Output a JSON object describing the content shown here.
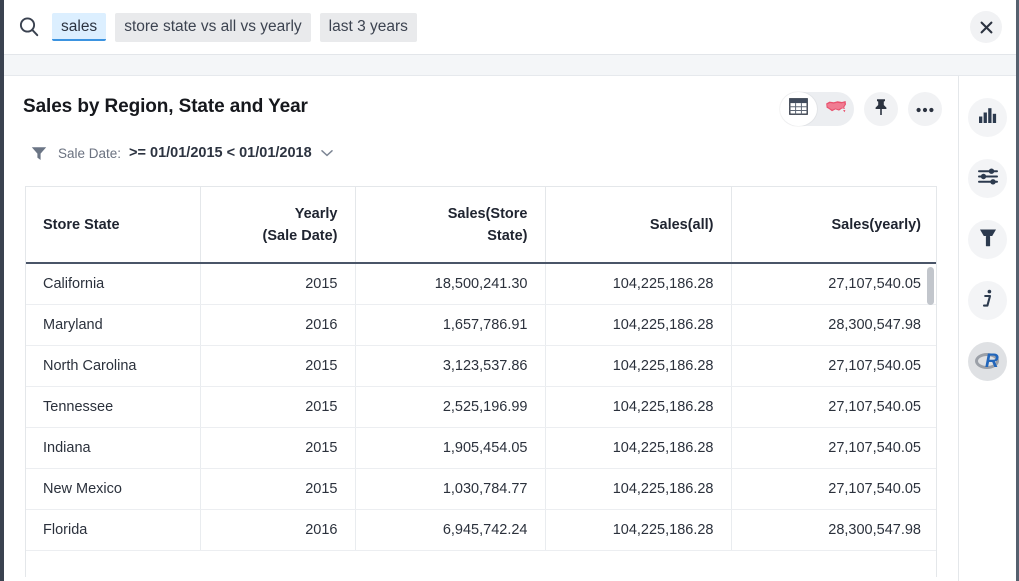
{
  "search": {
    "icon": "search-icon",
    "tokens": [
      {
        "label": "sales",
        "state": "active"
      },
      {
        "label": "store state vs all vs yearly",
        "state": "plain"
      },
      {
        "label": "last 3 years",
        "state": "plain"
      }
    ],
    "close_label": "✕"
  },
  "card": {
    "title": "Sales by Region, State and Year",
    "view_toggle": {
      "options": [
        {
          "name": "table-view",
          "selected": true
        },
        {
          "name": "map-view",
          "selected": false
        }
      ]
    },
    "actions": [
      {
        "name": "pin-button",
        "icon": "pin-icon"
      },
      {
        "name": "more-button",
        "icon": "ellipsis-icon"
      }
    ]
  },
  "filter": {
    "icon": "filter-icon",
    "label": "Sale Date:",
    "value": ">= 01/01/2015 < 01/01/2018",
    "caret": "chevron-down-icon"
  },
  "table": {
    "columns": [
      "Store State",
      "Yearly\n(Sale Date)",
      "Sales(Store\nState)",
      "Sales(all)",
      "Sales(yearly)"
    ],
    "columns_lines": [
      [
        "Store State"
      ],
      [
        "Yearly",
        "(Sale Date)"
      ],
      [
        "Sales(Store",
        "State)"
      ],
      [
        "Sales(all)"
      ],
      [
        "Sales(yearly)"
      ]
    ],
    "rows": [
      [
        "California",
        "2015",
        "18,500,241.30",
        "104,225,186.28",
        "27,107,540.05"
      ],
      [
        "Maryland",
        "2016",
        "1,657,786.91",
        "104,225,186.28",
        "28,300,547.98"
      ],
      [
        "North Carolina",
        "2015",
        "3,123,537.86",
        "104,225,186.28",
        "27,107,540.05"
      ],
      [
        "Tennessee",
        "2015",
        "2,525,196.99",
        "104,225,186.28",
        "27,107,540.05"
      ],
      [
        "Indiana",
        "2015",
        "1,905,454.05",
        "104,225,186.28",
        "27,107,540.05"
      ],
      [
        "New Mexico",
        "2015",
        "1,030,784.77",
        "104,225,186.28",
        "27,107,540.05"
      ],
      [
        "Florida",
        "2016",
        "6,945,742.24",
        "104,225,186.28",
        "28,300,547.98"
      ]
    ]
  },
  "rail": {
    "items": [
      {
        "name": "chart-icon"
      },
      {
        "name": "sliders-icon"
      },
      {
        "name": "funnel-icon"
      },
      {
        "name": "info-icon"
      },
      {
        "name": "r-logo-icon",
        "label": "R"
      }
    ]
  },
  "colors": {
    "accent_blue": "#3b93e0",
    "token_active_bg": "#dcefff",
    "dark_text": "#2c3340",
    "map_red": "#e8526e",
    "r_blue": "#2266bb"
  }
}
